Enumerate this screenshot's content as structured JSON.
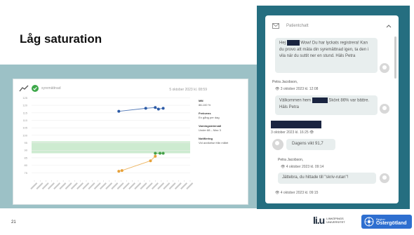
{
  "slide": {
    "title": "Låg saturation",
    "number": "21"
  },
  "chart": {
    "title": "syremättnad",
    "date": "5 oktober 2023 kl. 08:59",
    "info": {
      "blocks": [
        {
          "label": "Mål",
          "value": "88-100 %"
        },
        {
          "label": "Frekvens",
          "value": "En gång per dag"
        },
        {
          "label": "Varningsintervall",
          "value": "Under 88 – Max 3"
        },
        {
          "label": "Notifiering",
          "value": "Vid avvikelse från målet"
        }
      ]
    }
  },
  "chart_data": {
    "type": "scatter",
    "title": "",
    "xlabel": "",
    "ylabel": "",
    "ylim": [
      70,
      128
    ],
    "yticks": [
      75,
      80,
      85,
      90,
      95,
      100,
      105,
      110,
      115,
      120,
      125
    ],
    "target_band": [
      88,
      96
    ],
    "series": [
      {
        "values": [
          [
            0.55,
            116
          ],
          [
            0.72,
            118
          ],
          [
            0.78,
            118.5
          ],
          [
            0.8,
            117.5
          ],
          [
            0.83,
            118
          ]
        ]
      },
      {
        "values": [
          [
            0.55,
            76
          ],
          [
            0.57,
            76.5
          ],
          [
            0.75,
            83
          ],
          [
            0.78,
            86
          ]
        ]
      },
      {
        "values": [
          [
            0.78,
            88
          ],
          [
            0.81,
            88
          ],
          [
            0.83,
            88
          ]
        ]
      }
    ],
    "colors": [
      "#2b5aa6",
      "#e8a23a",
      "#43a047"
    ]
  },
  "chat": {
    "header": "Patientchatt",
    "messages": [
      {
        "text_before": "Hej",
        "text_after": "Wow! Du har lyckats registrera! Kan du provo att mäta din syremättnad igen, ta den i vila när du suttit ner en stund. Häls Petra"
      },
      {
        "sender": "Petra Jacobson,",
        "time": "3 oktober 2023 kl. 12:08"
      },
      {
        "text_before": "Välkommen hem",
        "text_after": "Skönt 86% var bättre. Häls Petra"
      },
      {
        "time": "3 oktober 2023 kl. 16:25"
      },
      {
        "text": "Dagens vikt 91,7"
      },
      {
        "sender": "Petra Jacobson,",
        "time": "4 oktober 2023 kl. 09:14"
      },
      {
        "text": "Jättebra, du hittade till \"skriv-rutan\"!"
      },
      {
        "time": "4 oktober 2023 kl. 09:15"
      }
    ]
  },
  "logos": {
    "liu_mark": "li.u",
    "liu_text_1": "LINKÖPINGS",
    "liu_text_2": "UNIVERSITET",
    "region_small": "Region",
    "region_name": "Östergötland"
  }
}
